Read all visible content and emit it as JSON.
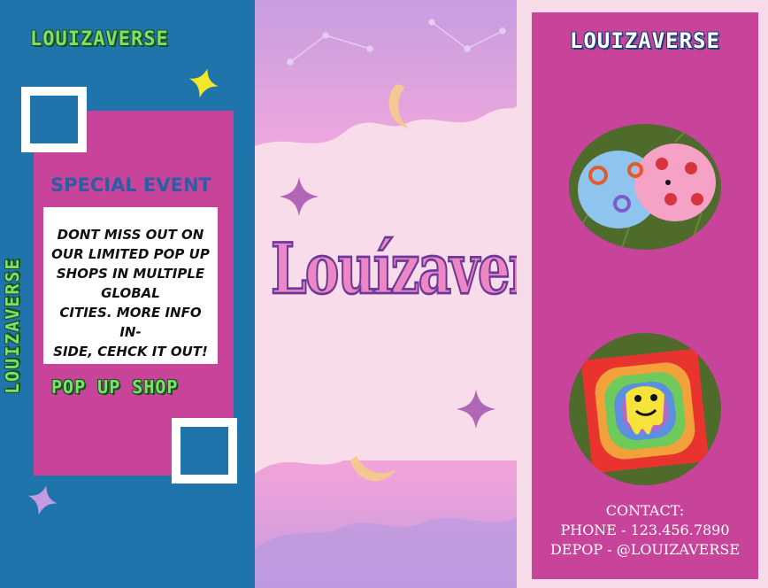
{
  "brand": "LOUIZAVERSE",
  "colors": {
    "blue": "#1f74ab",
    "pink": "#c8439a",
    "light_pink": "#f7dbe9",
    "green": "#7ee06a",
    "yellow": "#f4e62a",
    "lavender": "#c49be0"
  },
  "left_panel": {
    "top_title": "LOUIZAVERSE",
    "vertical_title": "LOUIZAVERSE",
    "special_event": "SPECIAL EVENT",
    "event_lines": [
      "DONT MISS OUT ON",
      "OUR LIMITED POP UP",
      "SHOPS IN MULTIPLE",
      "GLOBAL",
      "CITIES. MORE INFO IN-",
      "SIDE, CEHCK IT OUT!"
    ],
    "pop_up": "POP UP SHOP"
  },
  "middle_panel": {
    "brand_word": "Louízaverse"
  },
  "right_panel": {
    "title": "LOUIZAVERSE",
    "contact_label": "CONTACT:",
    "phone": "PHONE - 123.456.7890",
    "depop": "DEPOP - @LOUIZAVERSE"
  }
}
